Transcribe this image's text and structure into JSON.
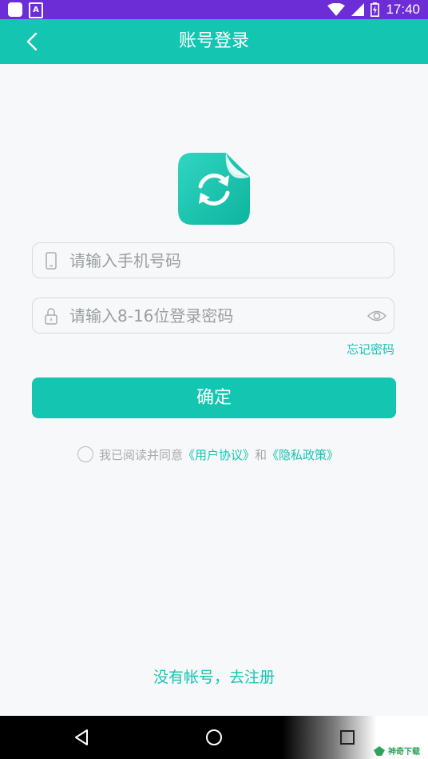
{
  "status_bar": {
    "time": "17:40",
    "icons": [
      "notification-icon",
      "a-icon",
      "wifi-icon",
      "signal-icon",
      "battery-icon"
    ]
  },
  "header": {
    "title": "账号登录",
    "back_icon": "back-arrow-icon"
  },
  "logo": {
    "icon": "sync-document-icon"
  },
  "phone_field": {
    "placeholder": "请输入手机号码",
    "value": "",
    "icon": "phone-icon"
  },
  "password_field": {
    "placeholder": "请输入8-16位登录密码",
    "value": "",
    "icon": "lock-icon",
    "toggle_icon": "eye-icon"
  },
  "forgot_password": "忘记密码",
  "confirm_button": "确定",
  "agreement": {
    "prefix": "我已阅读并同意",
    "user_agreement": "《用户协议》",
    "and": "和",
    "privacy_policy": "《隐私政策》",
    "checked": false
  },
  "register_link": "没有帐号，去注册",
  "nav_bar": {
    "buttons": [
      "back-triangle-icon",
      "home-circle-icon",
      "recents-square-icon"
    ]
  },
  "watermark": "神奇下载",
  "colors": {
    "accent": "#14c6b2",
    "status_bar": "#6c2cd6",
    "background": "#f7f8f9",
    "placeholder": "#9a9ea3"
  }
}
